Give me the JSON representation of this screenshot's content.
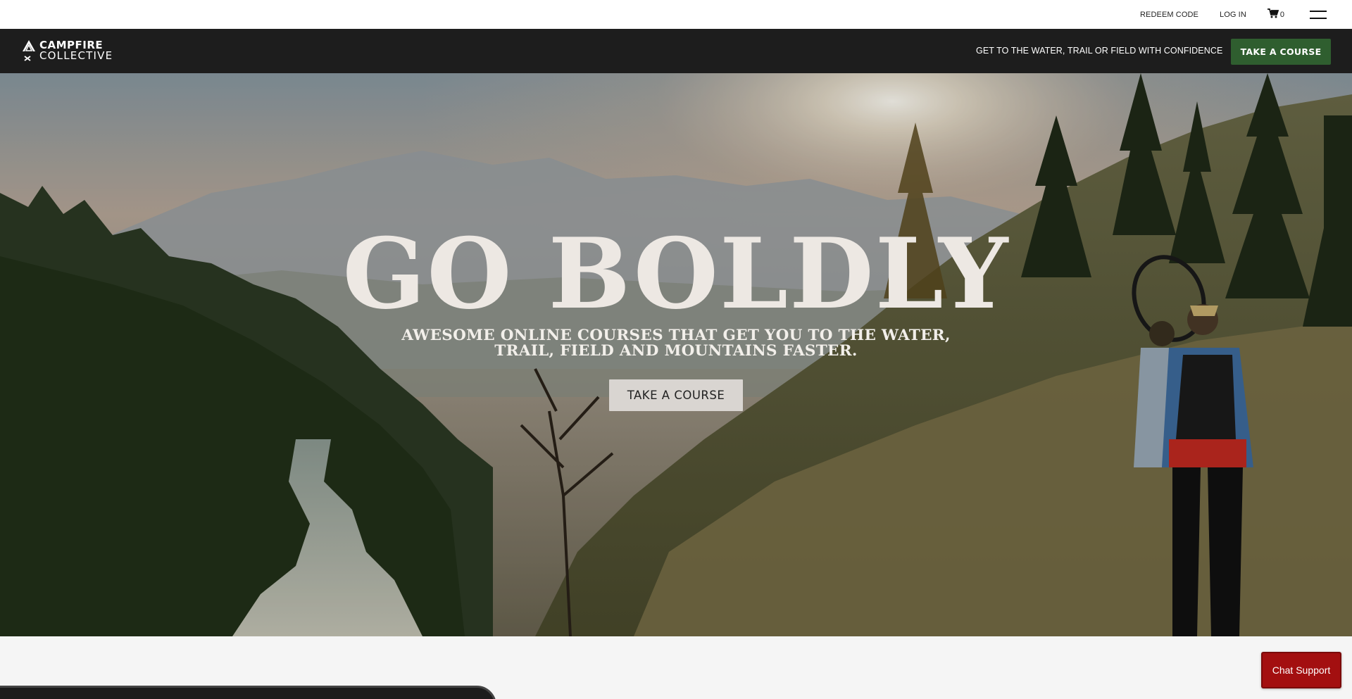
{
  "utility_bar": {
    "redeem_label": "REDEEM CODE",
    "login_label": "LOG IN",
    "cart_count": "0"
  },
  "header": {
    "logo_line1": "CAMPFIRE",
    "logo_line2": "COLLECTIVE",
    "tagline": "GET TO THE WATER, TRAIL OR FIELD WITH CONFIDENCE",
    "cta_label": "TAKE A COURSE"
  },
  "hero": {
    "title": "GO BOLDLY",
    "subtitle": "AWESOME ONLINE COURSES THAT GET YOU TO THE WATER, TRAIL, FIELD AND MOUNTAINS FASTER.",
    "cta_label": "TAKE A COURSE"
  },
  "chat": {
    "label": "Chat Support"
  },
  "colors": {
    "header_bg": "#1d1d1d",
    "header_cta": "#2f5e2f",
    "chat_bg": "#a30f10"
  },
  "icons": [
    "logo-mark-icon",
    "cart-icon",
    "menu-icon"
  ]
}
